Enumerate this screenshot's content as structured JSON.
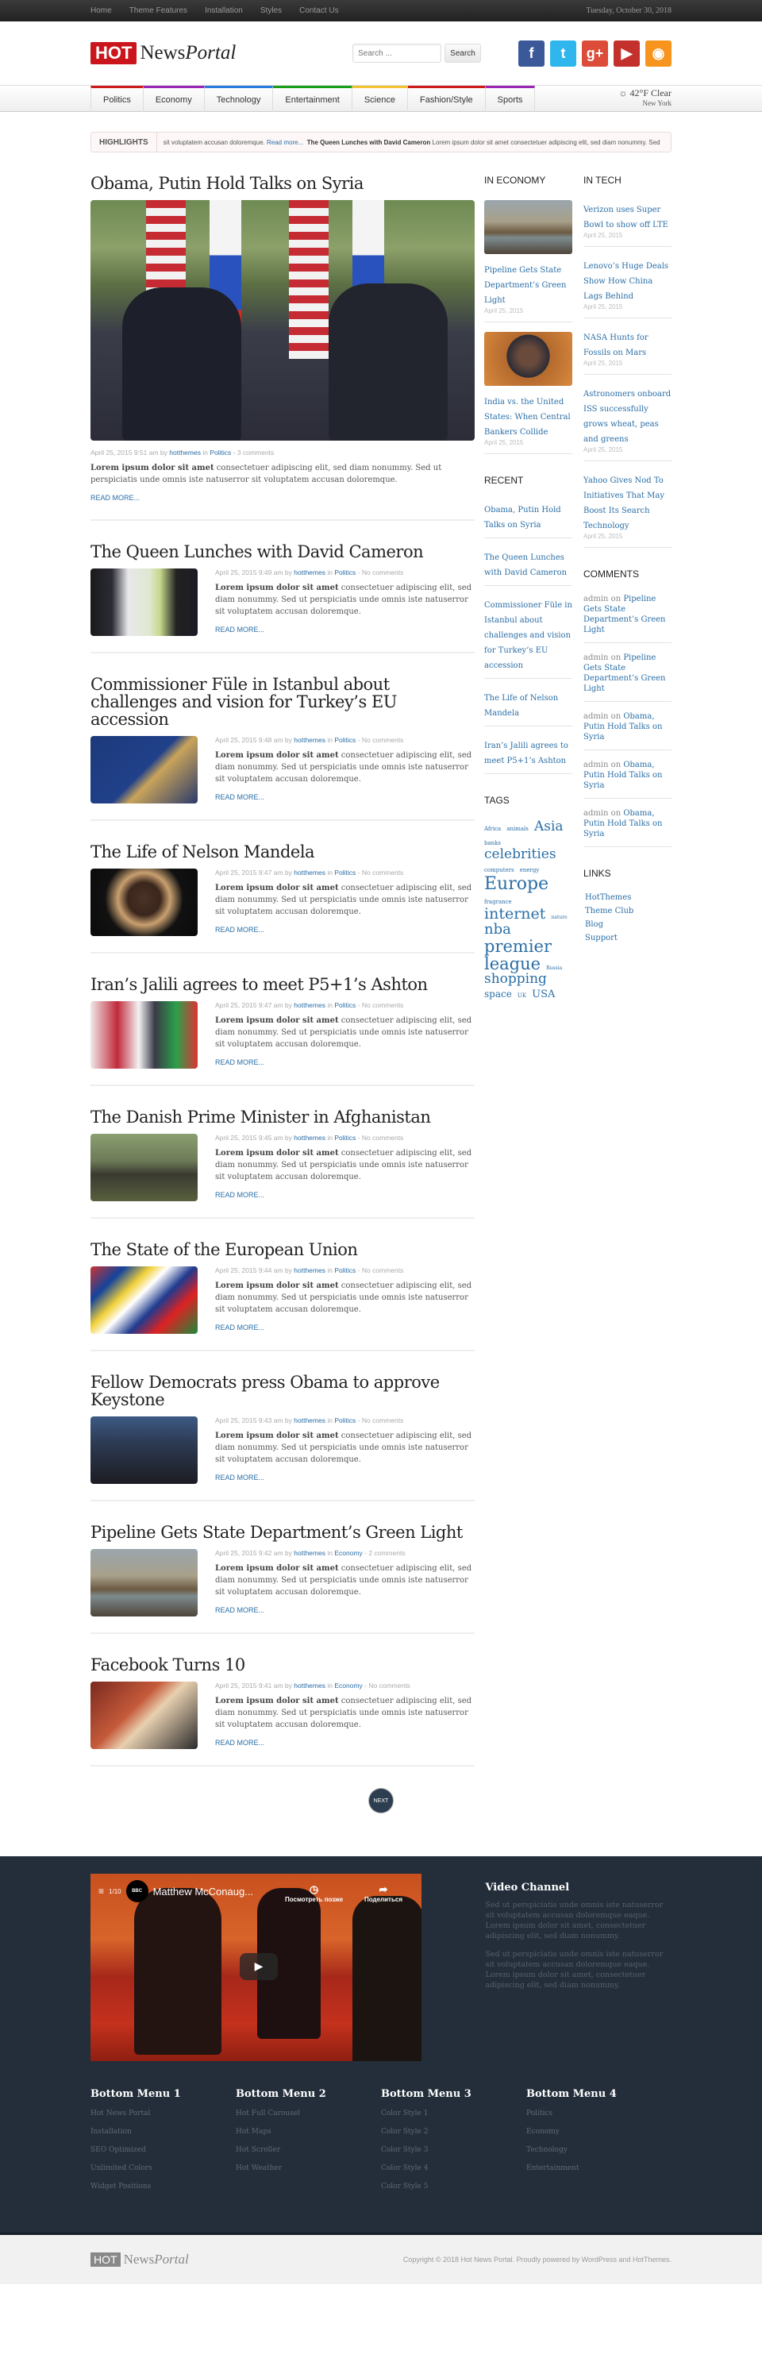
{
  "topbar": {
    "menu": [
      "Home",
      "Theme Features",
      "Installation",
      "Styles",
      "Contact Us"
    ],
    "date": "Tuesday, October 30, 2018"
  },
  "header": {
    "logo_hot": "HOT",
    "logo_news": "News",
    "logo_portal": "Portal",
    "search_placeholder": "Search ...",
    "search_button": "Search",
    "social": [
      {
        "name": "facebook",
        "glyph": "f",
        "color": "#3b5998"
      },
      {
        "name": "twitter",
        "glyph": "t",
        "color": "#2fb6ec"
      },
      {
        "name": "google-plus",
        "glyph": "g+",
        "color": "#dd4b39"
      },
      {
        "name": "youtube",
        "glyph": "▶",
        "color": "#c4302b"
      },
      {
        "name": "rss",
        "glyph": "◉",
        "color": "#f7941d"
      }
    ]
  },
  "nav": {
    "items": [
      {
        "label": "Politics",
        "color": "#cc1b1b"
      },
      {
        "label": "Economy",
        "color": "#9b26b6"
      },
      {
        "label": "Technology",
        "color": "#2a7bde"
      },
      {
        "label": "Entertainment",
        "color": "#199e19"
      },
      {
        "label": "Science",
        "color": "#f2c230"
      },
      {
        "label": "Fashion/Style",
        "color": "#cc1b1b"
      },
      {
        "label": "Sports",
        "color": "#9b26b6"
      }
    ],
    "weather_temp": "☼ 42°F Clear",
    "weather_city": "New York"
  },
  "highlights": {
    "label": "HIGHLIGHTS",
    "lead": "sit voluptatem accusan doloremque.",
    "read_more": "Read more...",
    "title": "The Queen Lunches with David Cameron",
    "text": "Lorem ipsum dolor sit amet consectetuer adipiscing elit, sed diam nonummy. Sed"
  },
  "posts": [
    {
      "title": "Obama, Putin Hold Talks on Syria",
      "date": "April 25, 2015 9:51 am",
      "category": "Politics",
      "comments": "3 comments"
    },
    {
      "title": "The Queen Lunches with David Cameron",
      "date": "April 25, 2015 9:49 am",
      "category": "Politics",
      "comments": "No comments"
    },
    {
      "title": "Commissioner Füle in Istanbul about challenges and vision for Turkey’s EU accession",
      "date": "April 25, 2015 9:48 am",
      "category": "Politics",
      "comments": "No comments"
    },
    {
      "title": "The Life of Nelson Mandela",
      "date": "April 25, 2015 9:47 am",
      "category": "Politics",
      "comments": "No comments"
    },
    {
      "title": "Iran’s Jalili agrees to meet P5+1’s Ashton",
      "date": "April 25, 2015 9:47 am",
      "category": "Politics",
      "comments": "No comments"
    },
    {
      "title": "The Danish Prime Minister in Afghanistan",
      "date": "April 25, 2015 9:45 am",
      "category": "Politics",
      "comments": "No comments"
    },
    {
      "title": "The State of the European Union",
      "date": "April 25, 2015 9:44 am",
      "category": "Politics",
      "comments": "No comments"
    },
    {
      "title": "Fellow Democrats press Obama to approve Keystone",
      "date": "April 25, 2015 9:43 am",
      "category": "Politics",
      "comments": "No comments"
    },
    {
      "title": "Pipeline Gets State Department’s Green Light",
      "date": "April 25, 2015 9:42 am",
      "category": "Economy",
      "comments": "2 comments"
    },
    {
      "title": "Facebook Turns 10",
      "date": "April 25, 2015 9:41 am",
      "category": "Economy",
      "comments": "No comments"
    }
  ],
  "post_common": {
    "by": "by",
    "author": "hotthemes",
    "in": "in",
    "dash": "-",
    "excerpt_bold": "Lorem ipsum dolor sit amet",
    "excerpt_rest": " consectetuer adipiscing elit, sed diam nonummy. Sed ut perspiciatis unde omnis iste natuserror sit voluptatem accusan doloremque.",
    "read_more": "READ MORE..."
  },
  "pagination": {
    "next": "NEXT"
  },
  "sidebar": {
    "economy": {
      "title": "IN ECONOMY",
      "items": [
        {
          "title": "Pipeline Gets State Department’s Green Light",
          "date": "April 25, 2015"
        },
        {
          "title": "India vs. the United States: When Central Bankers Collide",
          "date": "April 25, 2015"
        }
      ]
    },
    "recent": {
      "title": "RECENT",
      "items": [
        "Obama, Putin Hold Talks on Syria",
        "The Queen Lunches with David Cameron",
        "Commissioner Füle in Istanbul about challenges and vision for Turkey’s EU accession",
        "The Life of Nelson Mandela",
        "Iran’s Jalili agrees to meet P5+1’s Ashton"
      ]
    },
    "tags": {
      "title": "TAGS",
      "items": [
        {
          "label": "Africa",
          "size": 7
        },
        {
          "label": "animals",
          "size": 7
        },
        {
          "label": "Asia",
          "size": 17
        },
        {
          "label": "banks",
          "size": 7
        },
        {
          "label": "celebrities",
          "size": 17
        },
        {
          "label": "computers",
          "size": 7
        },
        {
          "label": "energy",
          "size": 7
        },
        {
          "label": "Europe",
          "size": 22
        },
        {
          "label": "fragrance",
          "size": 7
        },
        {
          "label": "internet",
          "size": 19
        },
        {
          "label": "nature",
          "size": 6
        },
        {
          "label": "nba",
          "size": 18
        },
        {
          "label": "premier",
          "size": 21
        },
        {
          "label": "league",
          "size": 21
        },
        {
          "label": "Russia",
          "size": 6
        },
        {
          "label": "shopping",
          "size": 17
        },
        {
          "label": "space",
          "size": 12
        },
        {
          "label": "UK",
          "size": 7
        },
        {
          "label": "USA",
          "size": 13
        }
      ]
    },
    "tech": {
      "title": "IN TECH",
      "items": [
        {
          "title": "Verizon uses Super Bowl to show off LTE",
          "date": "April 25, 2015"
        },
        {
          "title": "Lenovo’s Huge Deals Show How China Lags Behind",
          "date": "April 25, 2015"
        },
        {
          "title": "NASA Hunts for Fossils on Mars",
          "date": "April 25, 2015"
        },
        {
          "title": "Astronomers onboard ISS successfully grows wheat, peas and greens",
          "date": "April 25, 2015"
        },
        {
          "title": "Yahoo Gives Nod To Initiatives That May Boost Its Search Technology",
          "date": "April 25, 2015"
        }
      ]
    },
    "comments": {
      "title": "COMMENTS",
      "on": "on",
      "items": [
        {
          "author": "admin",
          "post": "Pipeline Gets State Department’s Green Light"
        },
        {
          "author": "admin",
          "post": "Pipeline Gets State Department’s Green Light"
        },
        {
          "author": "admin",
          "post": "Obama, Putin Hold Talks on Syria"
        },
        {
          "author": "admin",
          "post": "Obama, Putin Hold Talks on Syria"
        },
        {
          "author": "admin",
          "post": "Obama, Putin Hold Talks on Syria"
        }
      ]
    },
    "links": {
      "title": "LINKS",
      "items": [
        "HotThemes",
        "Theme Club",
        "Blog",
        "Support"
      ]
    }
  },
  "footer": {
    "video": {
      "counter": "1/10",
      "channel": "BBC",
      "title": "Matthew McConaug...",
      "watch_later": "Посмотреть позже",
      "share": "Поделиться"
    },
    "video_channel": {
      "title": "Video Channel",
      "paragraphs": [
        "Sed ut perspiciatis unde omnis iste natuserror sit voluptatem accusan doloremque eaque. Lorem ipsum dolor sit amet, consectetuer adipiscing elit, sed diam nonummy.",
        "Sed ut perspiciatis unde omnis iste natuserror sit voluptatem accusan doloremque eaque. Lorem ipsum dolor sit amet, consectetuer adipiscing elit, sed diam nonummy."
      ]
    },
    "menus": [
      {
        "title": "Bottom Menu 1",
        "items": [
          "Hot News Portal",
          "Installation",
          "SEO Optimized",
          "Unlimited Colors",
          "Widget Positions"
        ]
      },
      {
        "title": "Bottom Menu 2",
        "items": [
          "Hot Full Carousel",
          "Hot Maps",
          "Hot Scroller",
          "Hot Weather"
        ]
      },
      {
        "title": "Bottom Menu 3",
        "items": [
          "Color Style 1",
          "Color Style 2",
          "Color Style 3",
          "Color Style 4",
          "Color Style 5"
        ]
      },
      {
        "title": "Bottom Menu 4",
        "items": [
          "Politics",
          "Economy",
          "Technology",
          "Entertainment"
        ]
      }
    ],
    "copyright": "Copyright © 2018 Hot News Portal. Proudly powered by WordPress and HotThemes."
  }
}
